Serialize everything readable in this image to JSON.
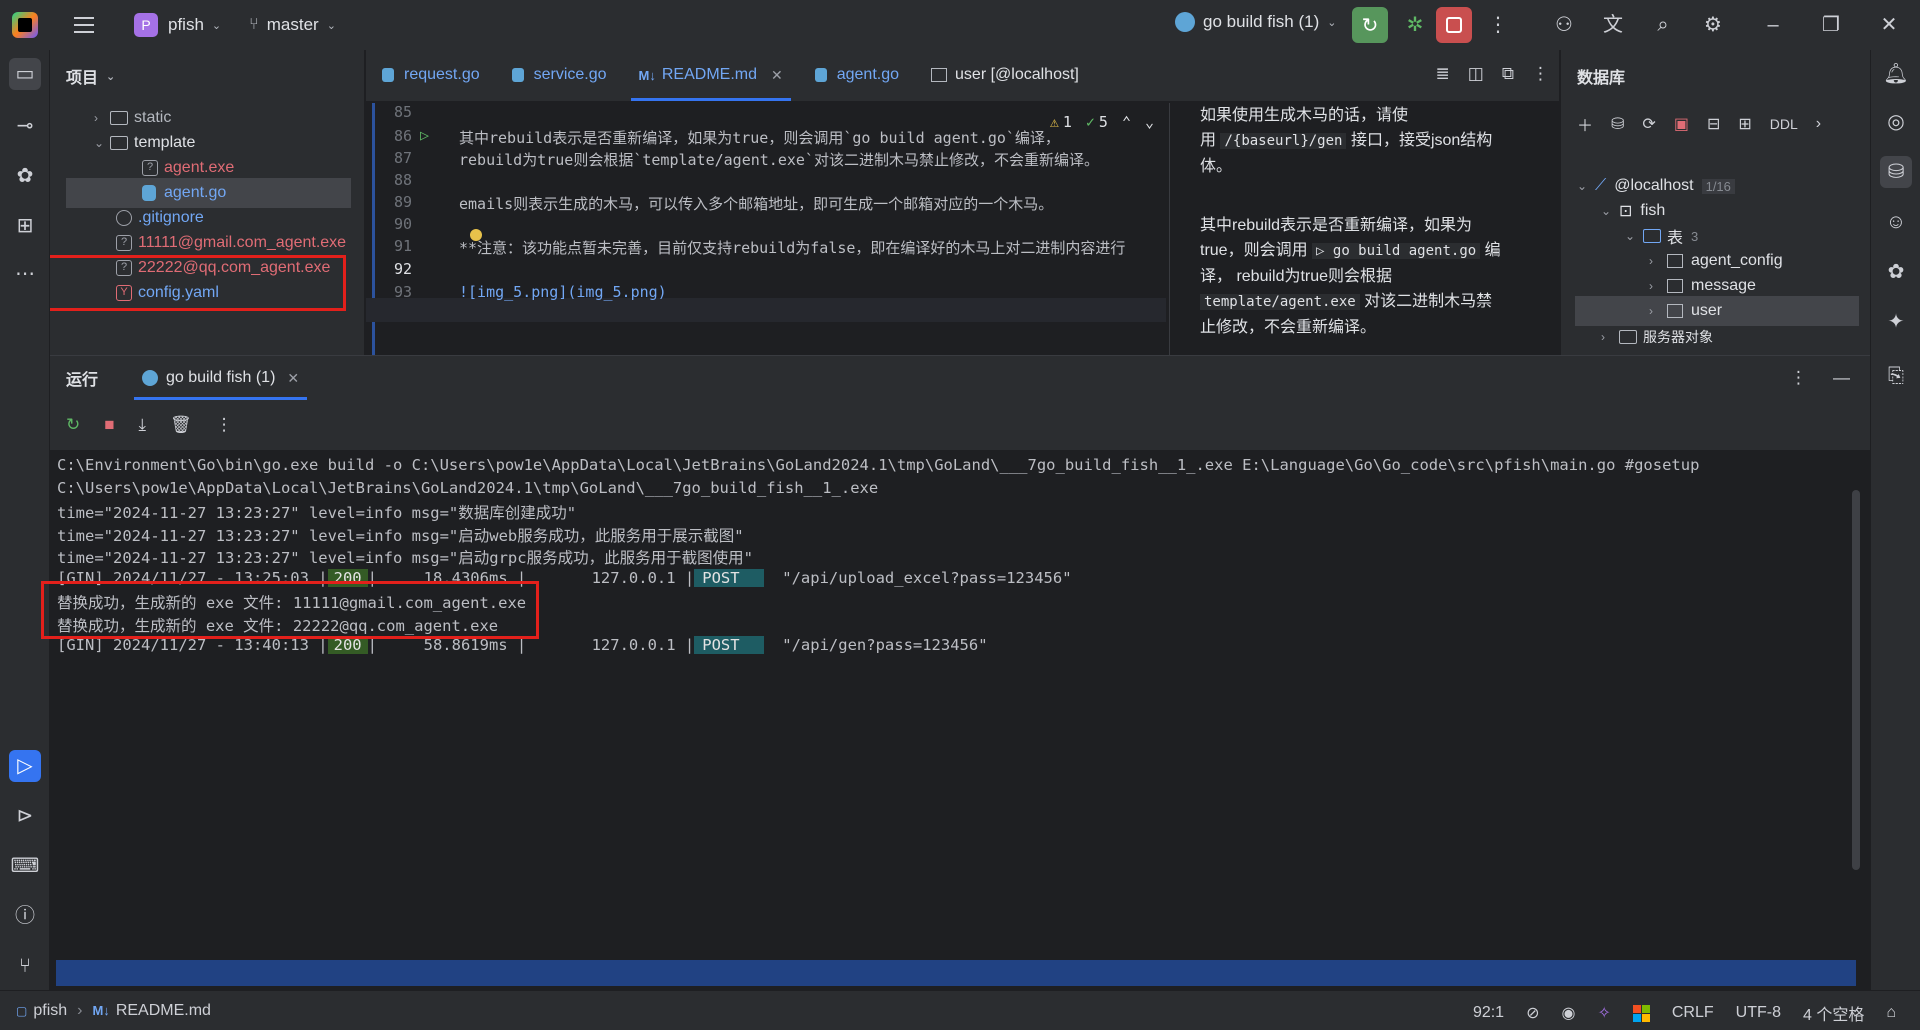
{
  "titlebar": {
    "project_badge": "P",
    "project": "pfish",
    "branch": "master",
    "run_config": "go build fish (1)"
  },
  "project_panel": {
    "title": "项目",
    "items": [
      {
        "label": "static",
        "type": "folder"
      },
      {
        "label": "template",
        "type": "folder"
      },
      {
        "label": "agent.exe",
        "type": "unknown"
      },
      {
        "label": "agent.go",
        "type": "go"
      },
      {
        "label": ".gitignore",
        "type": "ignore"
      },
      {
        "label": "11111@gmail.com_agent.exe",
        "type": "unknown"
      },
      {
        "label": "22222@qq.com_agent.exe",
        "type": "unknown"
      },
      {
        "label": "config.yaml",
        "type": "yaml"
      }
    ]
  },
  "editor": {
    "tabs": [
      "request.go",
      "service.go",
      "README.md",
      "agent.go",
      "user [@localhost]"
    ],
    "md_badge": "M↓",
    "inspection": {
      "warnings": "1",
      "ok": "5"
    },
    "lines": [
      {
        "n": "85",
        "text": ""
      },
      {
        "n": "86",
        "text": "其中rebuild表示是否重新编译，如果为true，则会调用`go build agent.go`编译，"
      },
      {
        "n": "87",
        "text": "rebuild为true则会根据`template/agent.exe`对该二进制木马禁止修改，不会重新编译。"
      },
      {
        "n": "88",
        "text": ""
      },
      {
        "n": "89",
        "text": "emails则表示生成的木马，可以传入多个邮箱地址，即可生成一个邮箱对应的一个木马。"
      },
      {
        "n": "90",
        "text": ""
      },
      {
        "n": "91",
        "text": "**注意：该功能点暂未完善，目前仅支持rebuild为false，即在编译好的木马上对二进制内容进行"
      },
      {
        "n": "92",
        "text": ""
      },
      {
        "n": "93",
        "text": "![img_5.png](img_5.png)"
      }
    ],
    "preview": {
      "p1a": "如果使用生成木马的话，请使",
      "p1b": "用",
      "p1code": "/{baseurl}/gen",
      "p1c": "接口，接受json结构",
      "p1d": "体。",
      "p2a": "其中rebuild表示是否重新编译，如果为",
      "p2b": "true，则会调用",
      "p2code": "go build agent.go",
      "p2c": "编",
      "p2d": "译， rebuild为true则会根据",
      "p2code2": "template/agent.exe",
      "p2e": "对该二进制木马禁",
      "p2f": "止修改，不会重新编译。"
    }
  },
  "db_panel": {
    "title": "数据库",
    "ddl": "DDL",
    "host": "@localhost",
    "host_count": "1/16",
    "schema": "fish",
    "tables_label": "表",
    "tables_count": "3",
    "tables": [
      "agent_config",
      "message",
      "user"
    ],
    "extra": "服务器对象"
  },
  "run_panel": {
    "title": "运行",
    "tab": "go build fish (1)",
    "lines": [
      "C:\\Environment\\Go\\bin\\go.exe build -o C:\\Users\\pow1e\\AppData\\Local\\JetBrains\\GoLand2024.1\\tmp\\GoLand\\___7go_build_fish__1_.exe E:\\Language\\Go\\Go_code\\src\\pfish\\main.go #gosetup",
      "C:\\Users\\pow1e\\AppData\\Local\\JetBrains\\GoLand2024.1\\tmp\\GoLand\\___7go_build_fish__1_.exe",
      "time=\"2024-11-27 13:23:27\" level=info msg=\"数据库创建成功\"",
      "time=\"2024-11-27 13:23:27\" level=info msg=\"启动web服务成功，此服务用于展示截图\"",
      "time=\"2024-11-27 13:23:27\" level=info msg=\"启动grpc服务成功，此服务用于截图使用\""
    ],
    "gin1": {
      "prefix": "[GIN] 2024/11/27 - 13:25:03 |",
      "code": "200",
      "mid": "|     18.4306ms |       127.0.0.1 |",
      "method": "POST",
      "path": "\"/api/upload_excel?pass=123456\""
    },
    "replace1": "替换成功，生成新的 exe 文件: 11111@gmail.com_agent.exe",
    "replace2": "替换成功，生成新的 exe 文件: 22222@qq.com_agent.exe",
    "gin2": {
      "prefix": "[GIN] 2024/11/27 - 13:40:13 |",
      "code": "200",
      "mid": "|     58.8619ms |       127.0.0.1 |",
      "method": "POST",
      "path": "\"/api/gen?pass=123456\""
    }
  },
  "statusbar": {
    "project": "pfish",
    "file": "README.md",
    "md_badge": "M↓",
    "position": "92:1",
    "line_sep": "CRLF",
    "encoding": "UTF-8",
    "indent": "4 个空格"
  },
  "colors": {
    "accent": "#3574f0",
    "highlight_box": "#e3201b",
    "run_green": "#57965c",
    "stop_red": "#c94f4f"
  }
}
